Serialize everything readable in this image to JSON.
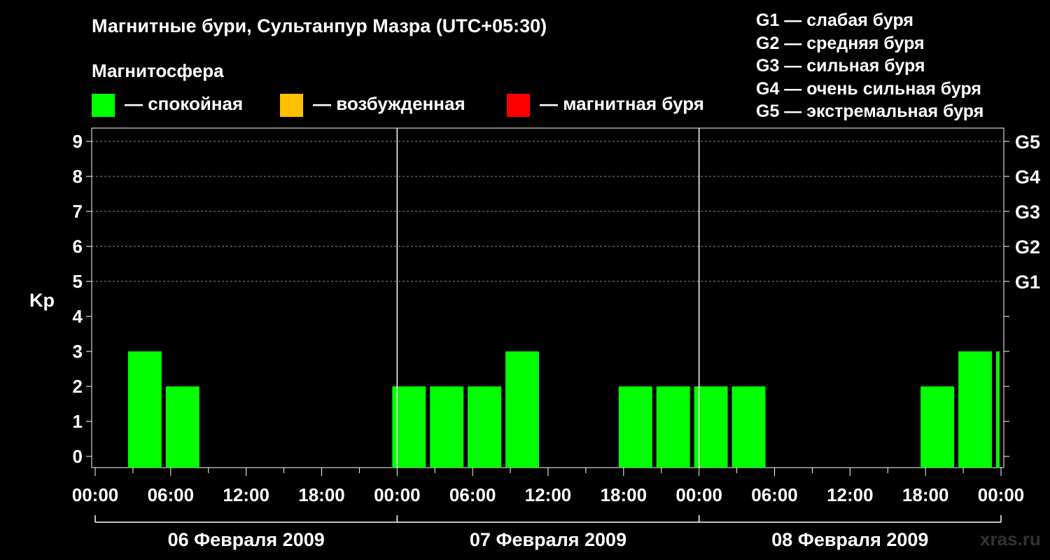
{
  "title": "Магнитные бури, Сультанпур Мазра (UTC+05:30)",
  "legend": {
    "heading": "Магнитосфера",
    "items": [
      {
        "color": "#00ff00",
        "label": "— спокойная"
      },
      {
        "color": "#ffc000",
        "label": "— возбужденная"
      },
      {
        "color": "#ff0000",
        "label": "— магнитная буря"
      }
    ]
  },
  "g_scale": [
    "G1 — слабая буря",
    "G2 — средняя буря",
    "G3 — сильная буря",
    "G4 — очень сильная буря",
    "G5 — экстремальная буря"
  ],
  "watermark": "xras.ru",
  "chart_data": {
    "type": "bar",
    "ylabel": "Kp",
    "ylim": [
      0,
      9
    ],
    "yticks": [
      0,
      1,
      2,
      3,
      4,
      5,
      6,
      7,
      8,
      9
    ],
    "right_axis_labels": [
      {
        "kp": 5,
        "label": "G1"
      },
      {
        "kp": 6,
        "label": "G2"
      },
      {
        "kp": 7,
        "label": "G3"
      },
      {
        "kp": 8,
        "label": "G4"
      },
      {
        "kp": 9,
        "label": "G5"
      }
    ],
    "x_tick_labels": [
      "00:00",
      "06:00",
      "12:00",
      "18:00",
      "00:00",
      "06:00",
      "12:00",
      "18:00",
      "00:00",
      "06:00",
      "12:00",
      "18:00",
      "00:00"
    ],
    "days": [
      "06 Февраля 2009",
      "07 Февраля 2009",
      "08 Февраля 2009"
    ],
    "bar_color": "#00ff00",
    "bars": [
      {
        "start": "2009-02-06 02:30",
        "kp": 2
      },
      {
        "start": "2009-02-06 05:30",
        "kp": 1
      },
      {
        "start": "2009-02-06 23:30",
        "kp": 1
      },
      {
        "start": "2009-02-07 02:30",
        "kp": 1
      },
      {
        "start": "2009-02-07 05:30",
        "kp": 1
      },
      {
        "start": "2009-02-07 08:30",
        "kp": 2
      },
      {
        "start": "2009-02-07 17:30",
        "kp": 1
      },
      {
        "start": "2009-02-07 20:30",
        "kp": 1
      },
      {
        "start": "2009-02-07 23:30",
        "kp": 1
      },
      {
        "start": "2009-02-08 02:30",
        "kp": 1
      },
      {
        "start": "2009-02-08 17:30",
        "kp": 1
      },
      {
        "start": "2009-02-08 20:30",
        "kp": 2
      },
      {
        "start": "2009-02-08 23:30",
        "kp": 2
      }
    ],
    "grid": true
  }
}
